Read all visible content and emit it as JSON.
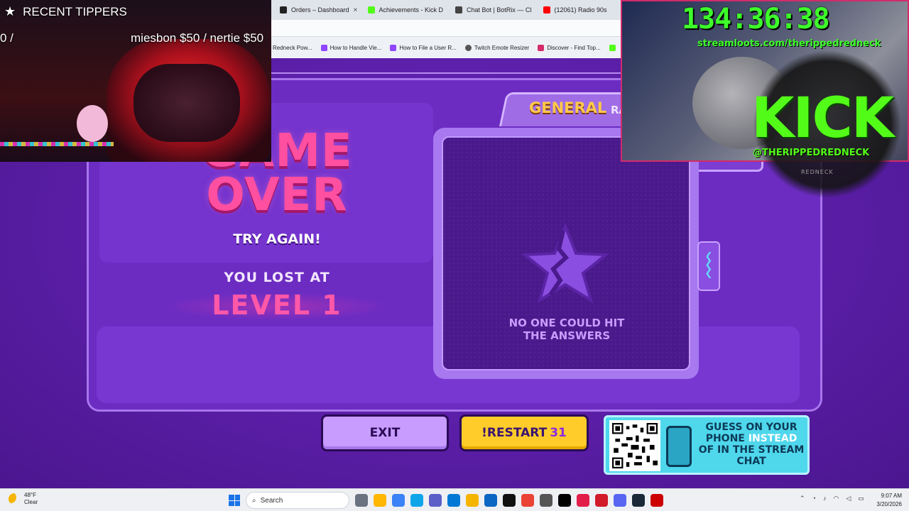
{
  "browser": {
    "tabs": [
      {
        "label": "Orders – Dashboard",
        "color": "#222222"
      },
      {
        "label": "Achievements - Kick D",
        "color": "#53fc18"
      },
      {
        "label": "Chat Bot | BotRix — Cl",
        "color": "#444444"
      },
      {
        "label": "(12061) Radio 90s",
        "color": "#ff0000"
      }
    ],
    "tab_close": "×",
    "bookmarks": [
      {
        "label": "Redneck Pow...",
        "color": "#888888"
      },
      {
        "label": "How to Handle Vie...",
        "color": "#9146ff"
      },
      {
        "label": "How to File a User R...",
        "color": "#9146ff"
      },
      {
        "label": "Twitch Emote Resizer",
        "color": "#555555"
      },
      {
        "label": "Discover - Find Top...",
        "color": "#d62b6b"
      },
      {
        "label": "",
        "color": "#53fc18"
      }
    ]
  },
  "game": {
    "game_over_line1": "GAME",
    "game_over_line2": "OVER",
    "try_again": "TRY AGAIN!",
    "lost_at": "YOU LOST AT",
    "level": "LEVEL 1",
    "ranking_title": "GENERAL",
    "ranking_subtitle": "RANKING",
    "no_one_line1": "NO ONE COULD HIT",
    "no_one_line2": "THE ANSWERS",
    "exit_label": "EXIT",
    "restart_label": "!RESTART",
    "restart_count": "31",
    "qr_text_a": "GUESS ON YOUR PHONE",
    "qr_text_hl": "INSTEAD",
    "qr_text_b": "OF IN THE STREAM CHAT"
  },
  "overlay_left": {
    "title": "RECENT TIPPERS",
    "tip_left": "0 /",
    "tip_right": "miesbon $50 / nertie $50"
  },
  "overlay_right": {
    "timer": "134:36:38",
    "loots_url": "streamloots.com/therippedredneck",
    "kick_logo": "KICK",
    "kick_handle": "@THERIPPEDREDNECK",
    "redneck_text": "REDNECK"
  },
  "taskbar": {
    "weather_temp": "48°F",
    "weather_desc": "Clear",
    "search_placeholder": "Search",
    "time": "9:07 AM",
    "date": "3/20/2026",
    "icon_colors": [
      "#6b7280",
      "#ffb703",
      "#3b82f6",
      "#0ea5e9",
      "#5b5fc7",
      "#0078d4",
      "#f5b400",
      "#0a66c2",
      "#111111",
      "#ea4335",
      "#555555",
      "#000000",
      "#e11d48",
      "#d11a2a",
      "#5865f2",
      "#1b2838",
      "#cc0000"
    ]
  }
}
